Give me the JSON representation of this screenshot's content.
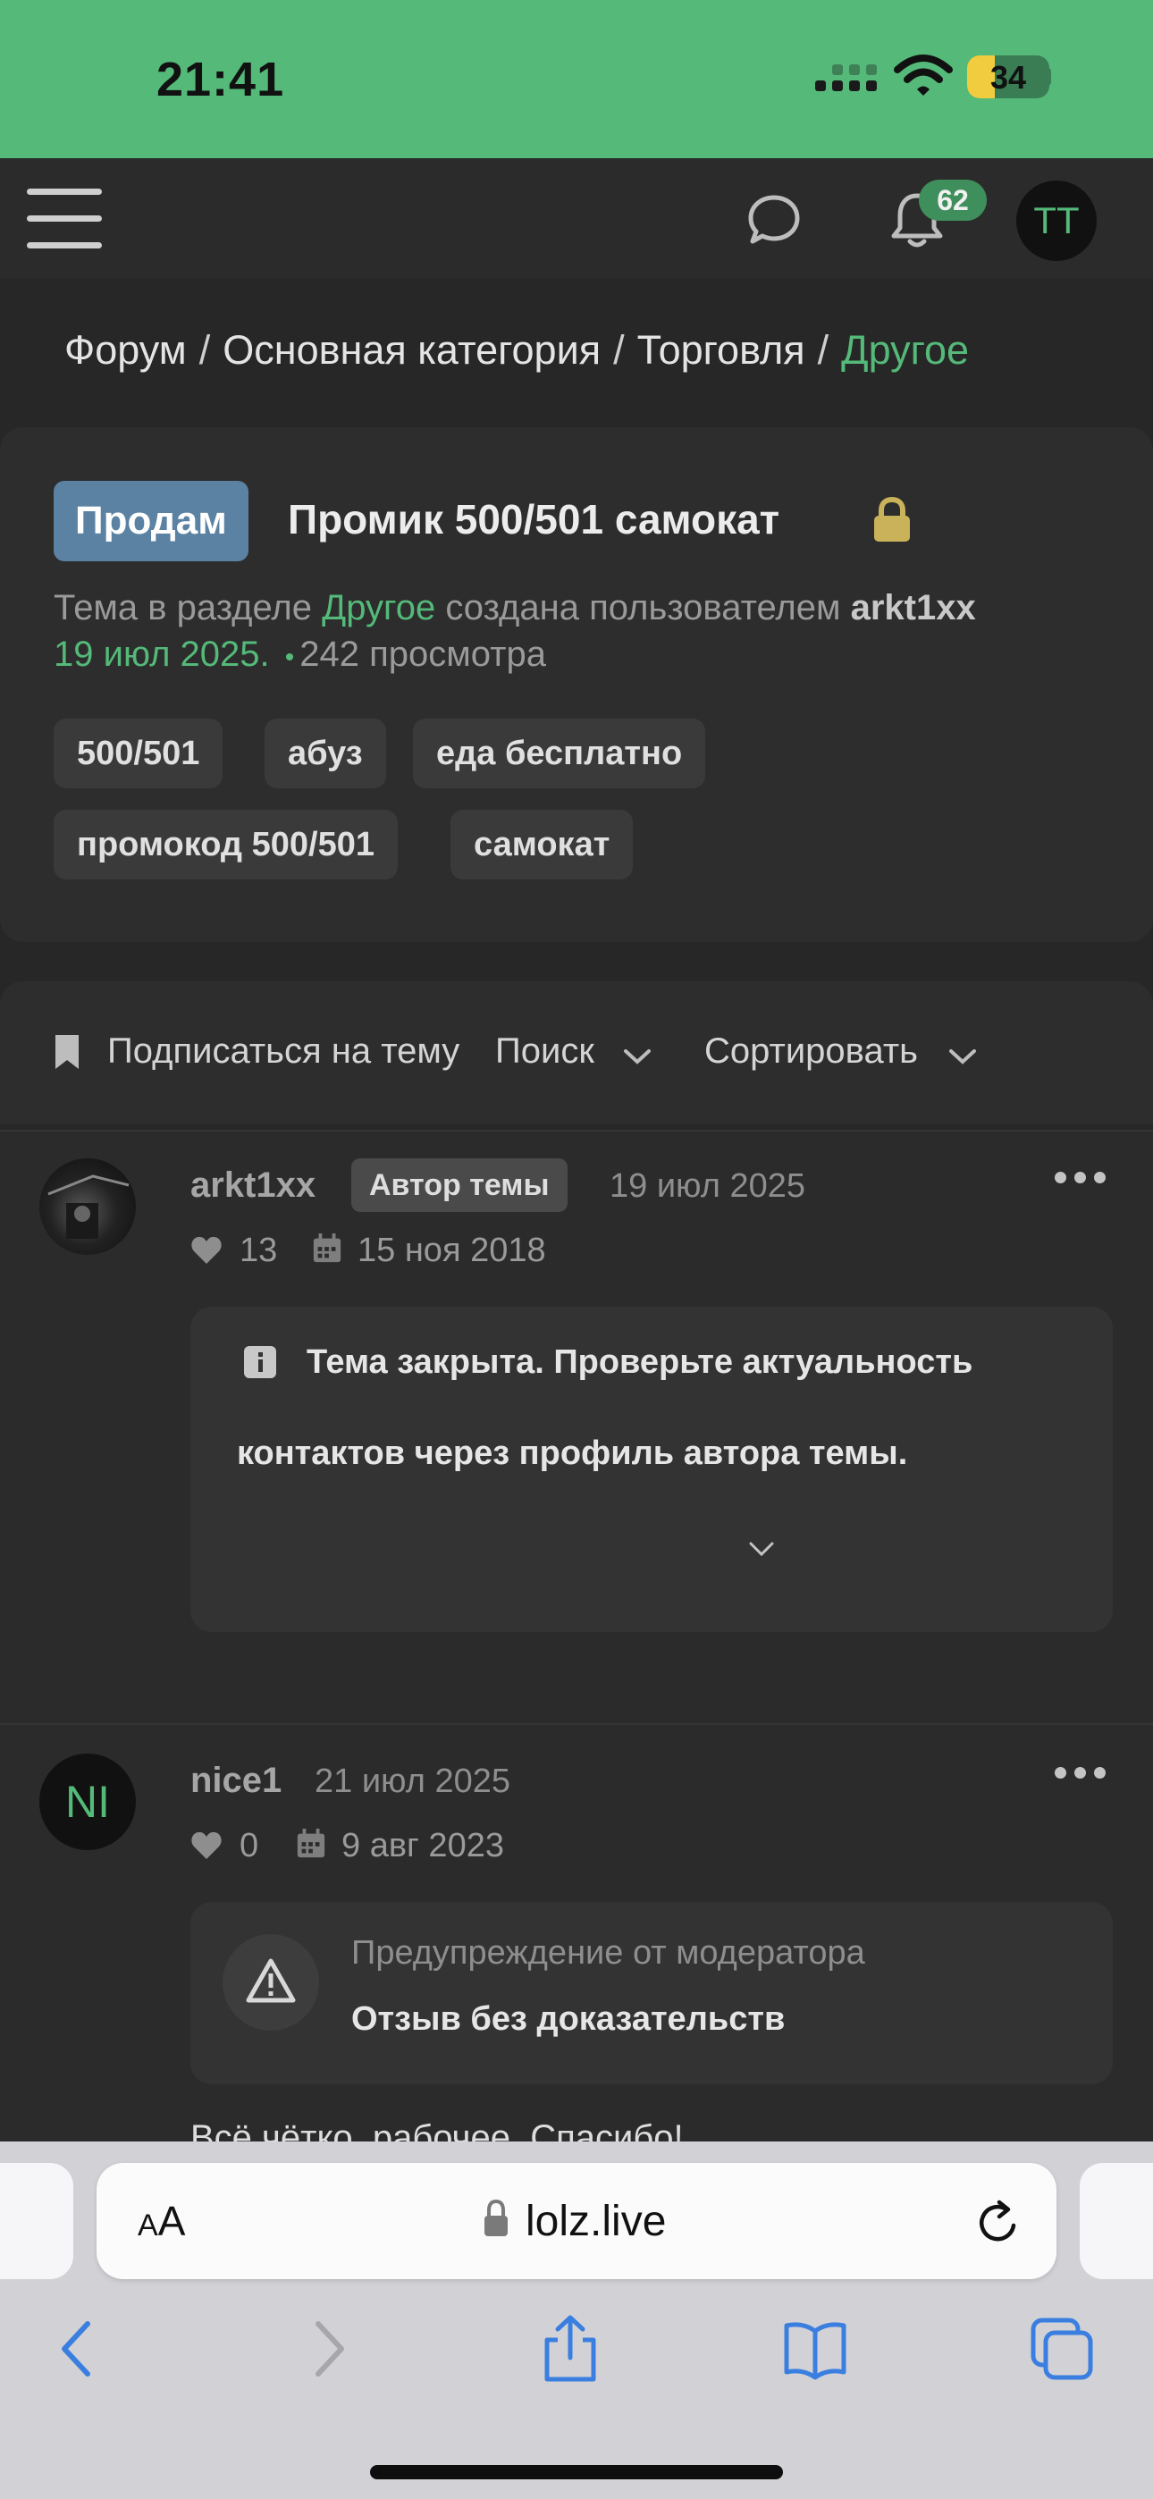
{
  "status_bar": {
    "time": "21:41",
    "battery": "34"
  },
  "topnav": {
    "notifications_count": "62",
    "user_initials": "TT"
  },
  "breadcrumb": [
    "Форум",
    "Основная категория",
    "Торговля",
    "Другое"
  ],
  "thread": {
    "prefix": "Продам",
    "title": "Промик 500/501 самокат",
    "meta_prefix": "Тема в разделе ",
    "meta_section": "Другое",
    "meta_created": " создана пользователем ",
    "meta_author": "arkt1xx",
    "meta_date": "19 июл 2025.",
    "meta_dot": "•",
    "meta_views": "242 просмотра",
    "tags": [
      "500/501",
      "абуз",
      "еда бесплатно",
      "промокод 500/501",
      "самокат"
    ]
  },
  "toolbar": {
    "subscribe": "Подписаться на тему",
    "search": "Поиск",
    "sort": "Сортировать"
  },
  "posts": [
    {
      "username": "arkt1xx",
      "badge": "Автор темы",
      "date": "19 июл 2025",
      "likes": "13",
      "registered": "15 ноя 2018",
      "notice_line1": "Тема закрыта. Проверьте актуальность",
      "notice_line2": "контактов через профиль автора темы."
    },
    {
      "username": "nice1",
      "avatar_initials": "NI",
      "date": "21 июл 2025",
      "likes": "0",
      "registered": "9 авг 2023",
      "warning_title": "Предупреждение от модератора",
      "warning_text": "Отзыв без доказательств",
      "body": "Всё чётко, рабочее. Спасибо!"
    }
  ],
  "browser": {
    "aa_small": "A",
    "aa_large": "A",
    "url": "lolz.live"
  },
  "colors": {
    "accent": "#54b979",
    "prefix_bg": "#5c82a3",
    "lock": "#c9b25a"
  }
}
